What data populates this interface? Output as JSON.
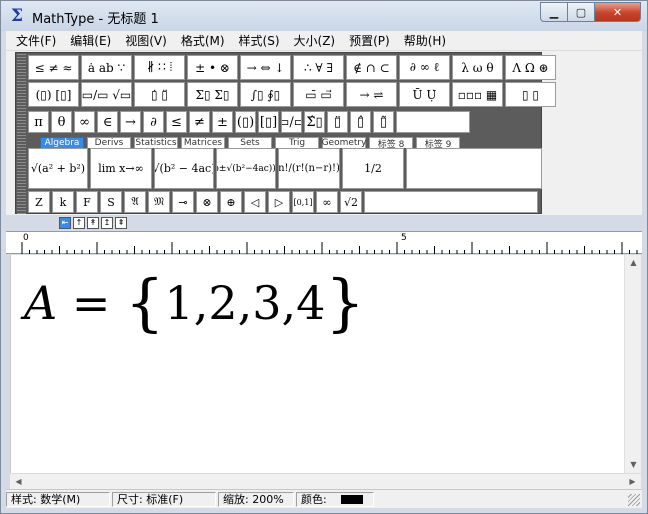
{
  "window": {
    "title": "MathType - 无标题 1",
    "app_icon": "Σ",
    "controls": {
      "minimize": "▁",
      "maximize": "▢",
      "close": "✕"
    }
  },
  "menu": [
    {
      "label": "文件(F)"
    },
    {
      "label": "编辑(E)"
    },
    {
      "label": "视图(V)"
    },
    {
      "label": "格式(M)"
    },
    {
      "label": "样式(S)"
    },
    {
      "label": "大小(Z)"
    },
    {
      "label": "预置(P)"
    },
    {
      "label": "帮助(H)"
    }
  ],
  "palette": {
    "symbol_row": [
      "≤ ≠ ≈",
      "ȧ ab ∵",
      "∦ ∷ ⦙",
      "± • ⊗",
      "→ ⇔ ↓",
      "∴ ∀ ∃",
      "∉ ∩ ⊂",
      "∂ ∞ ℓ",
      "λ ω θ",
      "Λ Ω ⊛"
    ],
    "template_row": [
      "(▯) [▯]",
      "▭/▭ √▭",
      "▯̇ ▯̈",
      "Σ▯ Σ▯",
      "∫▯ ∮▯",
      "▭̄ ▭⃗",
      "→ ⇌",
      "Ū Ụ̇",
      "▫▫▫ ▦",
      "▯ ▯"
    ],
    "small_row": [
      "π",
      "θ",
      "∞",
      "∈",
      "→",
      "∂",
      "≤",
      "≠",
      "±",
      "(▯)",
      "[▯]",
      "▭/▭",
      "Σ̂▯",
      "▯̈",
      "▯̂",
      "▯̃"
    ],
    "tabs": [
      {
        "label": "Algebra",
        "active": true
      },
      {
        "label": "Derivs",
        "active": false
      },
      {
        "label": "Statistics",
        "active": false
      },
      {
        "label": "Matrices",
        "active": false
      },
      {
        "label": "Sets",
        "active": false
      },
      {
        "label": "Trig",
        "active": false
      },
      {
        "label": "Geometry",
        "active": false
      },
      {
        "label": "标签 8",
        "active": false
      },
      {
        "label": "标签 9",
        "active": false
      }
    ],
    "expression_row": [
      "√(a² + b²)",
      "lim x→∞",
      "√(b² − 4ac)",
      "(−b±√(b²−4ac))/2a",
      "n!/(r!(n−r)!)",
      "1/2"
    ],
    "style_row": [
      "Z",
      "k",
      "F",
      "S",
      "𝔄",
      "𝔐",
      "⊸",
      "⊗",
      "⊕",
      "◁",
      "▷",
      "[0,1]",
      "∞",
      "√2"
    ]
  },
  "small_tools": [
    "⇤",
    "↑",
    "↟",
    "↥",
    "⇞"
  ],
  "ruler": {
    "start_label": "0",
    "mid_label": "5"
  },
  "equation": {
    "lhs": "A",
    "rel": "=",
    "open": "{",
    "body": "1,2,3,4",
    "close": "}"
  },
  "status": {
    "style": "样式: 数学(M)",
    "size": "尺寸: 标准(F)",
    "zoom": "缩放: 200%",
    "color": "颜色:",
    "color_value": "#000000"
  },
  "scroll": {
    "up": "▲",
    "down": "▼",
    "left": "◀",
    "right": "▶"
  }
}
